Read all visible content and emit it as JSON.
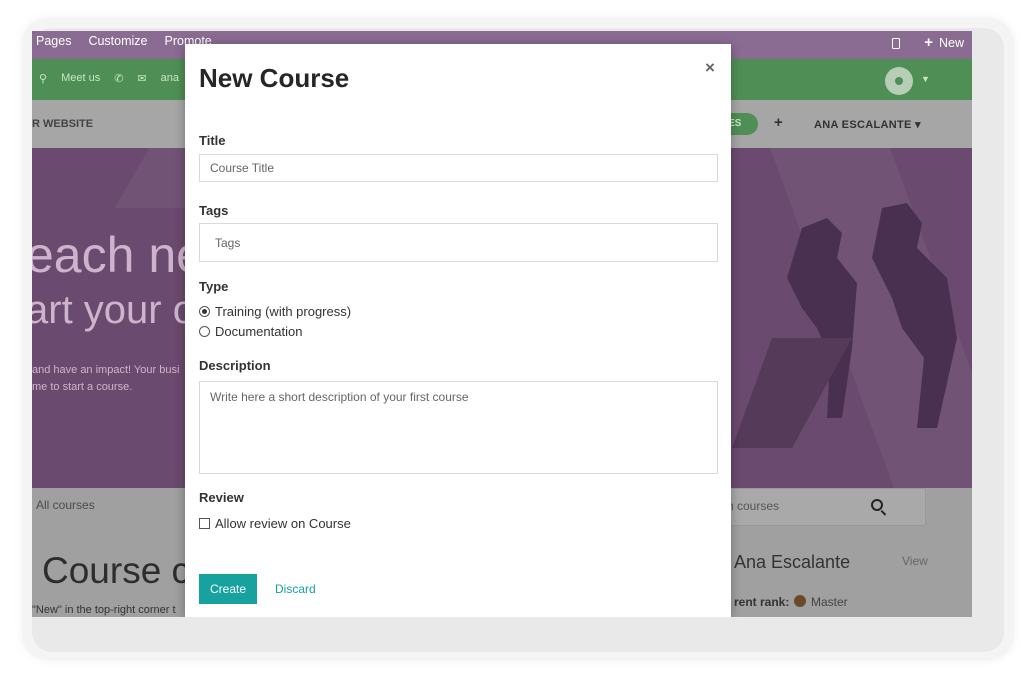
{
  "editor_bar": {
    "menu": [
      "Pages",
      "Customize",
      "Promote"
    ],
    "new_label": "New",
    "new_glyph": "+",
    "mobile_icon": "mobile-icon"
  },
  "contact_bar": {
    "meet_us": "Meet us",
    "email_partial": "ana"
  },
  "nav": {
    "brand_partial": "R WEBSITE",
    "pill_partial": "ES",
    "plus": "+",
    "user": "ANA ESCALANTE ▾"
  },
  "hero": {
    "line1": "each ne",
    "line2": "art your or",
    "sub1": "and have an impact! Your busi",
    "sub2": "me to start a course."
  },
  "lower": {
    "all_courses": "All courses",
    "search_placeholder": "ch courses",
    "big_title": "Course cr",
    "hint": "\"New\" in the top-right corner t",
    "user_name": "Ana Escalante",
    "view_link": "View",
    "rank_label": "rent rank:",
    "rank_value": "Master"
  },
  "modal": {
    "title": "New Course",
    "close": "×",
    "title_label": "Title",
    "title_placeholder": "Course Title",
    "tags_label": "Tags",
    "tags_placeholder": "Tags",
    "type_label": "Type",
    "type_options": [
      {
        "label": "Training (with progress)",
        "selected": true
      },
      {
        "label": "Documentation",
        "selected": false
      }
    ],
    "description_label": "Description",
    "description_placeholder": "Write here a short description of your first course",
    "review_label": "Review",
    "review_option": "Allow review on Course",
    "review_checked": false,
    "create_label": "Create",
    "discard_label": "Discard"
  },
  "colors": {
    "editor_bar": "#8a6b92",
    "contact_bar": "#4f8f55",
    "accent": "#17a2a0",
    "hero": "#6a4a6e"
  }
}
